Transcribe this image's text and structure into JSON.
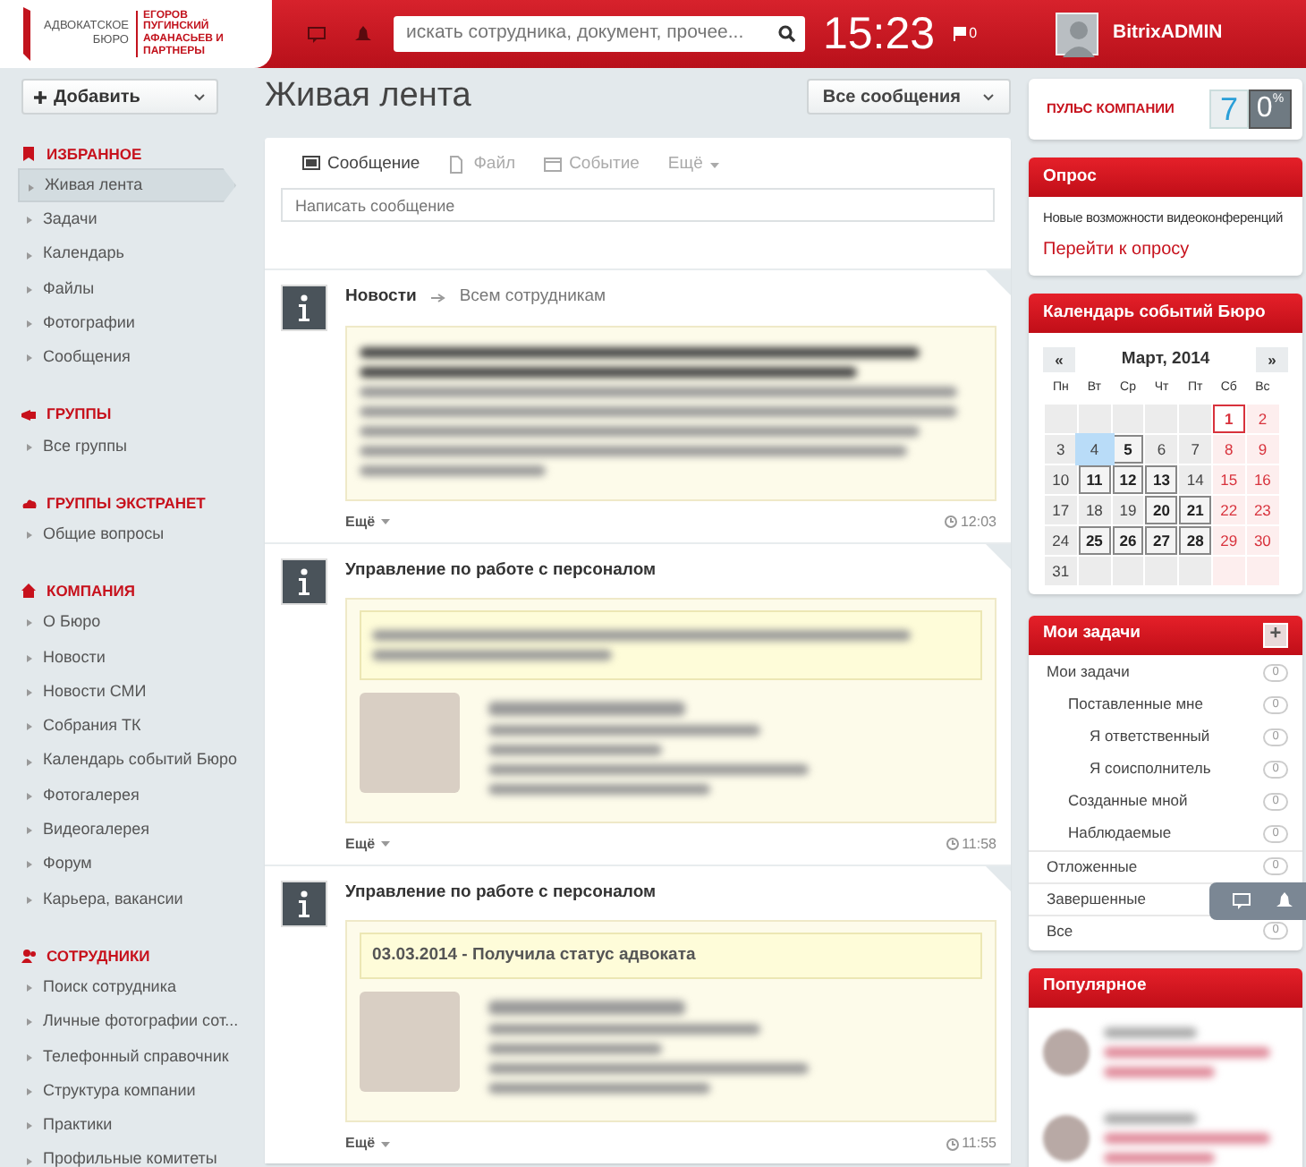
{
  "header": {
    "logo_left": "АДВОКАТСКОЕ БЮРО",
    "logo_right": "ЕГОРОВ ПУГИНСКИЙ АФАНАСЬЕВ И ПАРТНЕРЫ",
    "search": {
      "placeholder": "искать сотрудника, документ, прочее..."
    },
    "time": "15:23",
    "flag_count": "0",
    "user": "BitrixADMIN"
  },
  "toolbar": {
    "add_button": "Добавить",
    "page_title": "Живая лента",
    "filter": "Все сообщения"
  },
  "sidebar": [
    {
      "title": "ИЗБРАННОЕ",
      "items": [
        {
          "label": "Живая лента",
          "selected": true
        },
        {
          "label": "Задачи",
          "selected": false
        },
        {
          "label": "Календарь",
          "selected": false
        },
        {
          "label": "Файлы",
          "selected": false
        },
        {
          "label": "Фотографии",
          "selected": false
        },
        {
          "label": "Сообщения",
          "selected": false
        }
      ]
    },
    {
      "title": "ГРУППЫ",
      "items": [
        {
          "label": "Все группы",
          "selected": false
        }
      ]
    },
    {
      "title": "ГРУППЫ ЭКСТРАНЕТ",
      "items": [
        {
          "label": "Общие вопросы",
          "selected": false
        }
      ]
    },
    {
      "title": "КОМПАНИЯ",
      "items": [
        {
          "label": "О Бюро",
          "selected": false
        },
        {
          "label": "Новости",
          "selected": false
        },
        {
          "label": "Новости СМИ",
          "selected": false
        },
        {
          "label": "Собрания ТК",
          "selected": false
        },
        {
          "label": "Календарь событий Бюро",
          "selected": false
        },
        {
          "label": "Фотогалерея",
          "selected": false
        },
        {
          "label": "Видеогалерея",
          "selected": false
        },
        {
          "label": "Форум",
          "selected": false
        },
        {
          "label": "Карьера, вакансии",
          "selected": false
        }
      ]
    },
    {
      "title": "СОТРУДНИКИ",
      "items": [
        {
          "label": "Поиск сотрудника",
          "selected": false
        },
        {
          "label": "Личные фотографии сот...",
          "selected": false
        },
        {
          "label": "Телефонный справочник",
          "selected": false
        },
        {
          "label": "Структура компании",
          "selected": false
        },
        {
          "label": "Практики",
          "selected": false
        },
        {
          "label": "Профильные комитеты",
          "selected": false
        }
      ]
    }
  ],
  "composer": {
    "tabs": [
      {
        "label": "Сообщение",
        "selected": true
      },
      {
        "label": "Файл",
        "selected": false
      },
      {
        "label": "Событие",
        "selected": false
      },
      {
        "label": "Ещё",
        "selected": false
      }
    ],
    "placeholder": "Написать сообщение"
  },
  "posts": [
    {
      "kind": "news",
      "title": "Новости",
      "recipient": "Всем сотрудникам",
      "more": "Ещё",
      "time": "12:03"
    },
    {
      "kind": "hr",
      "title": "Управление по работе с персоналом",
      "event_redacted": true,
      "more": "Ещё",
      "time": "11:58"
    },
    {
      "kind": "hr",
      "title": "Управление по работе с персоналом",
      "event": "03.03.2014 - Получила статус адвоката",
      "more": "Ещё",
      "time": "11:55"
    }
  ],
  "pulse": {
    "title": "ПУЛЬС КОМПАНИИ",
    "count": "7",
    "percent": "0$^{%}$"
  },
  "poll": {
    "title": "Опрос",
    "question": "Новые возможности видеоконференций",
    "link": "Перейти к опросу"
  },
  "calendar": {
    "title": "Календарь событий Бюро",
    "prev": "«",
    "month": "Март, 2014",
    "next": "»",
    "weekdays": [
      "Пн",
      "Вт",
      "Ср",
      "Чт",
      "Пт",
      "Сб",
      "Вс"
    ],
    "weeks": [
      [
        {
          "kind": "blank"
        },
        {
          "kind": "blank"
        },
        {
          "kind": "blank"
        },
        {
          "kind": "blank"
        },
        {
          "kind": "blank"
        },
        {
          "kind": "day",
          "day": "1",
          "event": false,
          "today": true,
          "selected": false
        },
        {
          "kind": "day",
          "day": "2",
          "event": false,
          "today": false,
          "selected": false
        }
      ],
      [
        {
          "kind": "day",
          "day": "3",
          "event": false,
          "today": false,
          "selected": false
        },
        {
          "kind": "day",
          "day": "4",
          "event": false,
          "today": false,
          "selected": true
        },
        {
          "kind": "day",
          "day": "5",
          "event": true,
          "today": false,
          "selected": false
        },
        {
          "kind": "day",
          "day": "6",
          "event": false,
          "today": false,
          "selected": false
        },
        {
          "kind": "day",
          "day": "7",
          "event": false,
          "today": false,
          "selected": false
        },
        {
          "kind": "day",
          "day": "8",
          "event": false,
          "today": false,
          "selected": false
        },
        {
          "kind": "day",
          "day": "9",
          "event": false,
          "today": false,
          "selected": false
        }
      ],
      [
        {
          "kind": "day",
          "day": "10",
          "event": false,
          "today": false,
          "selected": false
        },
        {
          "kind": "day",
          "day": "11",
          "event": true,
          "today": false,
          "selected": false
        },
        {
          "kind": "day",
          "day": "12",
          "event": true,
          "today": false,
          "selected": false
        },
        {
          "kind": "day",
          "day": "13",
          "event": true,
          "today": false,
          "selected": false
        },
        {
          "kind": "day",
          "day": "14",
          "event": false,
          "today": false,
          "selected": false
        },
        {
          "kind": "day",
          "day": "15",
          "event": false,
          "today": false,
          "selected": false
        },
        {
          "kind": "day",
          "day": "16",
          "event": false,
          "today": false,
          "selected": false
        }
      ],
      [
        {
          "kind": "day",
          "day": "17",
          "event": false,
          "today": false,
          "selected": false
        },
        {
          "kind": "day",
          "day": "18",
          "event": false,
          "today": false,
          "selected": false
        },
        {
          "kind": "day",
          "day": "19",
          "event": false,
          "today": false,
          "selected": false
        },
        {
          "kind": "day",
          "day": "20",
          "event": true,
          "today": false,
          "selected": false
        },
        {
          "kind": "day",
          "day": "21",
          "event": true,
          "today": false,
          "selected": false
        },
        {
          "kind": "day",
          "day": "22",
          "event": false,
          "today": false,
          "selected": false
        },
        {
          "kind": "day",
          "day": "23",
          "event": false,
          "today": false,
          "selected": false
        }
      ],
      [
        {
          "kind": "day",
          "day": "24",
          "event": false,
          "today": false,
          "selected": false
        },
        {
          "kind": "day",
          "day": "25",
          "event": true,
          "today": false,
          "selected": false
        },
        {
          "kind": "day",
          "day": "26",
          "event": true,
          "today": false,
          "selected": false
        },
        {
          "kind": "day",
          "day": "27",
          "event": true,
          "today": false,
          "selected": false
        },
        {
          "kind": "day",
          "day": "28",
          "event": true,
          "today": false,
          "selected": false
        },
        {
          "kind": "day",
          "day": "29",
          "event": false,
          "today": false,
          "selected": false
        },
        {
          "kind": "day",
          "day": "30",
          "event": false,
          "today": false,
          "selected": false
        }
      ],
      [
        {
          "kind": "day",
          "day": "31",
          "event": false,
          "today": false,
          "selected": false
        },
        {
          "kind": "blank"
        },
        {
          "kind": "blank"
        },
        {
          "kind": "blank"
        },
        {
          "kind": "blank"
        },
        {
          "kind": "blank"
        },
        {
          "kind": "blank"
        }
      ]
    ]
  },
  "tasks": {
    "title": "Мои задачи",
    "add": "+",
    "items": [
      {
        "label": "Мои задачи",
        "count": "0",
        "children": [
          {
            "label": "Поставленные мне",
            "count": "0",
            "children": [
              {
                "label": "Я ответственный",
                "count": "0"
              },
              {
                "label": "Я соисполнитель",
                "count": "0"
              }
            ]
          },
          {
            "label": "Созданные мной",
            "count": "0"
          },
          {
            "label": "Наблюдаемые",
            "count": "0"
          }
        ]
      },
      {
        "label": "Отложенные",
        "count": "0"
      },
      {
        "label": "Завершенные"
      },
      {
        "label": "Все",
        "count": "0"
      }
    ]
  },
  "popular": {
    "title": "Популярное"
  }
}
